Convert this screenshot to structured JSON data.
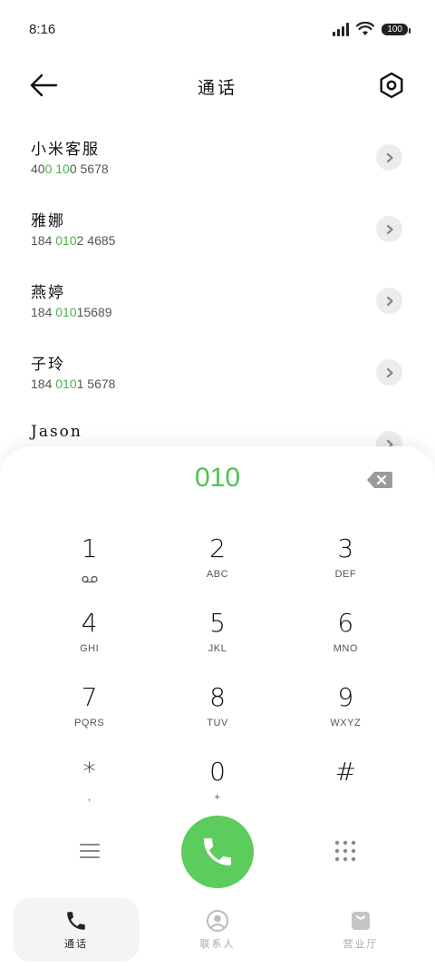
{
  "status": {
    "time": "8:16",
    "battery": "100"
  },
  "header": {
    "title": "通话"
  },
  "contacts": [
    {
      "name": "小米客服",
      "number": [
        [
          "40",
          false
        ],
        [
          "0 10",
          true
        ],
        [
          "0 5678",
          false
        ]
      ]
    },
    {
      "name": "雅娜",
      "number": [
        [
          "184 ",
          false
        ],
        [
          "010",
          true
        ],
        [
          "2 4685",
          false
        ]
      ]
    },
    {
      "name": "燕婷",
      "number": [
        [
          "184 ",
          false
        ],
        [
          "010",
          true
        ],
        [
          "15689",
          false
        ]
      ]
    },
    {
      "name": "子玲",
      "number": [
        [
          "184 ",
          false
        ],
        [
          "010",
          true
        ],
        [
          "1 5678",
          false
        ]
      ]
    },
    {
      "name": "Jason",
      "number": []
    }
  ],
  "dialer": {
    "entered": "010",
    "keys": [
      {
        "digit": "1",
        "letters": "",
        "icon": "voicemail-icon"
      },
      {
        "digit": "2",
        "letters": "ABC"
      },
      {
        "digit": "3",
        "letters": "DEF"
      },
      {
        "digit": "4",
        "letters": "GHI"
      },
      {
        "digit": "5",
        "letters": "JKL"
      },
      {
        "digit": "6",
        "letters": "MNO"
      },
      {
        "digit": "7",
        "letters": "PQRS"
      },
      {
        "digit": "8",
        "letters": "TUV"
      },
      {
        "digit": "9",
        "letters": "WXYZ"
      },
      {
        "digit": "*",
        "letters": ","
      },
      {
        "digit": "0",
        "letters": "+"
      },
      {
        "digit": "#",
        "letters": ""
      }
    ]
  },
  "tabs": [
    {
      "label": "通话",
      "icon": "phone-icon",
      "active": true
    },
    {
      "label": "联系人",
      "icon": "contacts-icon",
      "active": false
    },
    {
      "label": "营业厅",
      "icon": "store-bag-icon",
      "active": false
    }
  ],
  "colors": {
    "accent": "#5ccc5c",
    "highlight": "#4ab84a"
  }
}
